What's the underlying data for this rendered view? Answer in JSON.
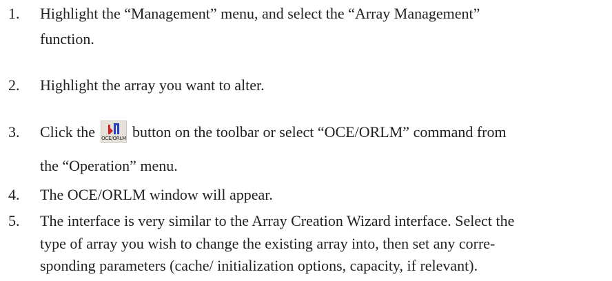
{
  "steps": [
    {
      "number": "1.",
      "lines": [
        "Highlight the “Management” menu, and select the “Array Management”",
        "function."
      ]
    },
    {
      "number": "2.",
      "lines": [
        "Highlight the array you want to alter."
      ]
    },
    {
      "number": "3.",
      "lines": [
        "Click the",
        "button on the toolbar or select “OCE/ORLM” command from",
        "the “Operation” menu."
      ]
    },
    {
      "number": "4.",
      "lines": [
        "The OCE/ORLM window will appear."
      ]
    },
    {
      "number": "5.",
      "lines": [
        "The interface is very similar to the Array Creation Wizard interface.  Select the",
        "type of array you wish to change the existing array into, then set any corre-",
        "sponding parameters (cache/ initialization options, capacity, if relevant)."
      ]
    }
  ],
  "toolbar_button": {
    "caption": "OCE/ORLM",
    "icon": "oce-orlm-icon"
  },
  "colors": {
    "text": "#222222",
    "icon_red": "#d02020",
    "icon_blue": "#2040c0"
  }
}
